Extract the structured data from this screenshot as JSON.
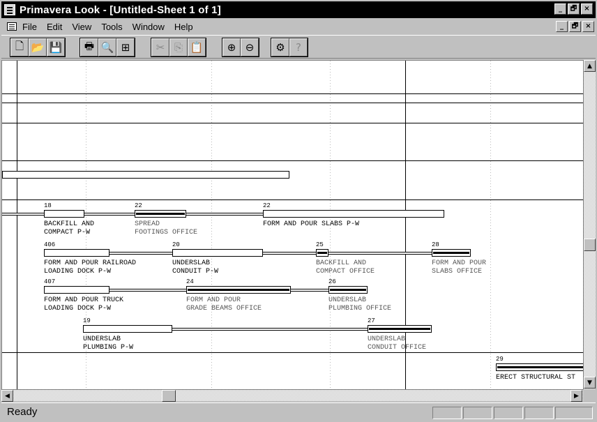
{
  "window": {
    "title": "Primavera Look - [Untitled-Sheet 1 of 1]"
  },
  "title_buttons": [
    "_",
    "🗗",
    "×"
  ],
  "menu": {
    "items": [
      "File",
      "Edit",
      "View",
      "Tools",
      "Window",
      "Help"
    ]
  },
  "toolbar": {
    "groups": [
      [
        {
          "icon": "new-file-icon",
          "glyph": "🗋",
          "enabled": true
        },
        {
          "icon": "open-folder-icon",
          "glyph": "📂",
          "enabled": true
        },
        {
          "icon": "save-disk-icon",
          "glyph": "💾",
          "enabled": true
        }
      ],
      [
        {
          "icon": "print-icon",
          "glyph": "🖶",
          "enabled": true
        },
        {
          "icon": "print-preview-icon",
          "glyph": "🔍",
          "enabled": true
        },
        {
          "icon": "page-setup-icon",
          "glyph": "⊞",
          "enabled": true
        }
      ],
      [
        {
          "icon": "cut-icon",
          "glyph": "✂",
          "enabled": false
        },
        {
          "icon": "copy-icon",
          "glyph": "⎘",
          "enabled": false
        },
        {
          "icon": "paste-icon",
          "glyph": "📋",
          "enabled": true
        }
      ],
      [
        {
          "icon": "zoom-in-icon",
          "glyph": "⊕",
          "enabled": true
        },
        {
          "icon": "zoom-out-icon",
          "glyph": "⊖",
          "enabled": true
        }
      ],
      [
        {
          "icon": "options-icon",
          "glyph": "⚙",
          "enabled": true
        },
        {
          "icon": "help-pointer-icon",
          "glyph": "?",
          "enabled": false
        }
      ]
    ]
  },
  "activities": [
    {
      "num": "18",
      "label": [
        "BACKFILL AND",
        "COMPACT P-W"
      ],
      "critical": false
    },
    {
      "num": "22",
      "label": [
        "SPREAD",
        "FOOTINGS OFFICE"
      ],
      "critical": true
    },
    {
      "num": "22",
      "label": [
        "FORM AND POUR SLABS P-W"
      ],
      "critical": false
    },
    {
      "num": "406",
      "label": [
        "FORM AND POUR RAILROAD",
        "LOADING DOCK P-W"
      ],
      "critical": false
    },
    {
      "num": "20",
      "label": [
        "UNDERSLAB",
        "CONDUIT P-W"
      ],
      "critical": false
    },
    {
      "num": "25",
      "label": [
        "BACKFILL AND",
        "COMPACT OFFICE"
      ],
      "critical": true
    },
    {
      "num": "28",
      "label": [
        "FORM AND POUR",
        "SLABS OFFICE"
      ],
      "critical": true
    },
    {
      "num": "407",
      "label": [
        "FORM AND POUR TRUCK",
        "LOADING DOCK P-W"
      ],
      "critical": false
    },
    {
      "num": "24",
      "label": [
        "FORM AND POUR",
        "GRADE BEAMS OFFICE"
      ],
      "critical": true
    },
    {
      "num": "26",
      "label": [
        "UNDERSLAB",
        "PLUMBING OFFICE"
      ],
      "critical": true
    },
    {
      "num": "19",
      "label": [
        "UNDERSLAB",
        "PLUMBING P-W"
      ],
      "critical": false
    },
    {
      "num": "27",
      "label": [
        "UNDERSLAB",
        "CONDUIT OFFICE"
      ],
      "critical": true
    },
    {
      "num": "29",
      "label": [
        "ERECT STRUCTURAL ST"
      ],
      "critical": true
    }
  ],
  "status": {
    "text": "Ready"
  }
}
